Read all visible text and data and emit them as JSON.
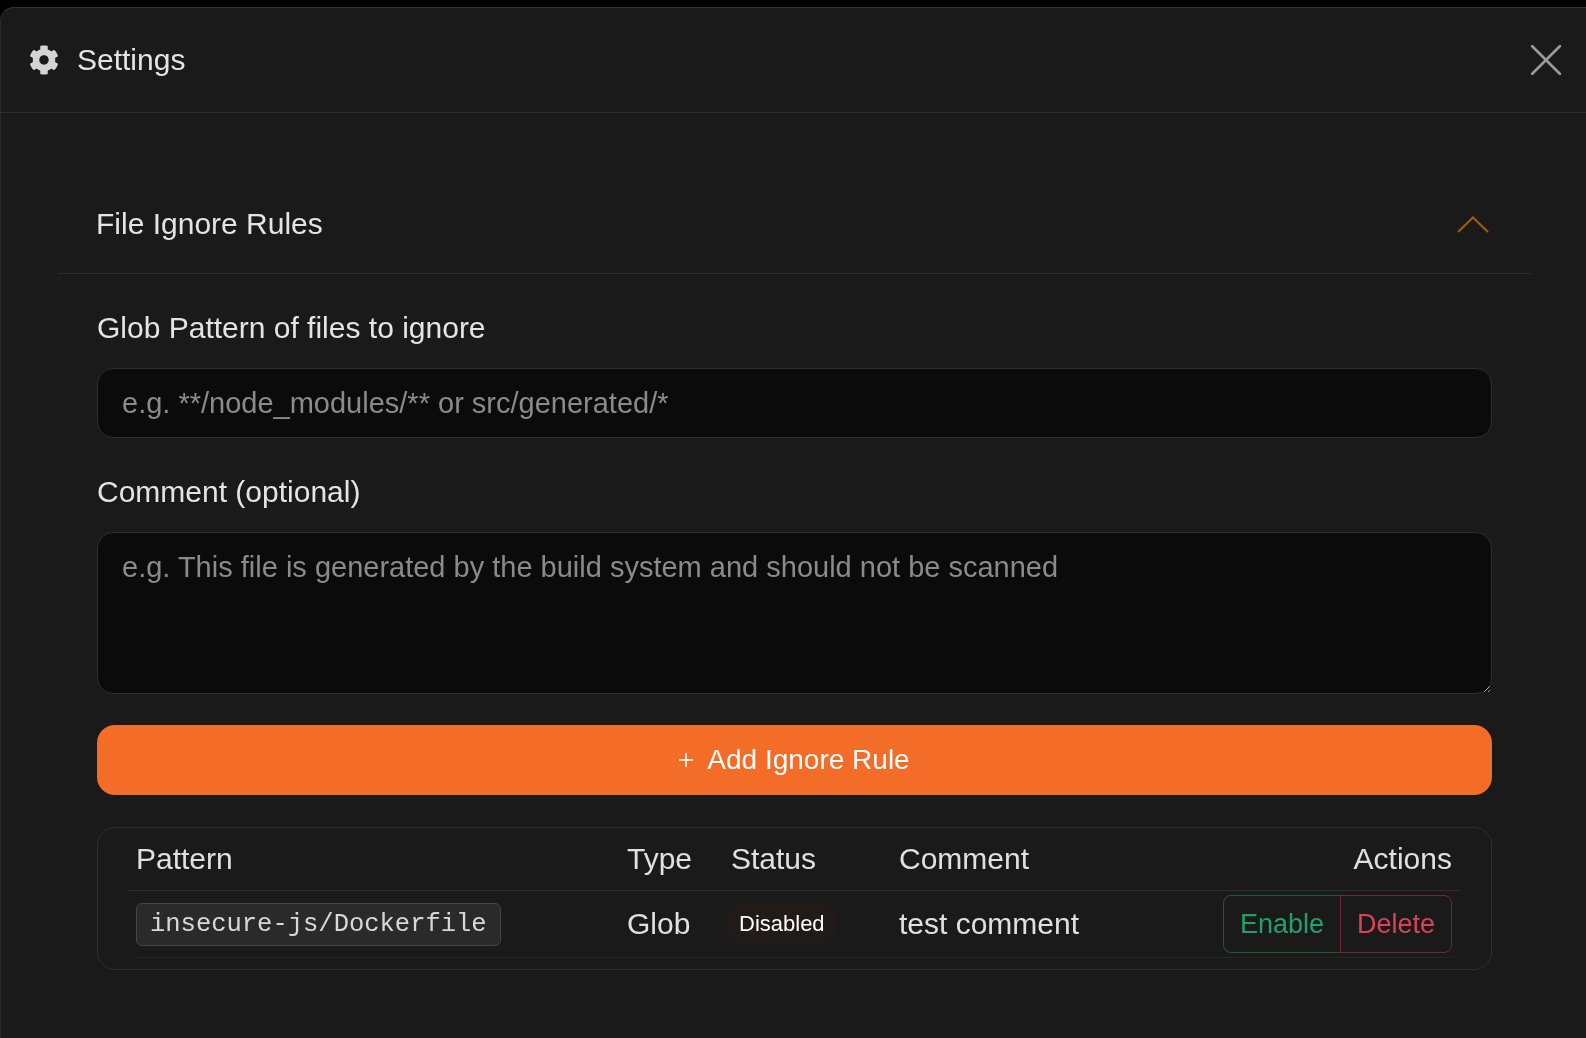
{
  "window": {
    "title": "Settings"
  },
  "section": {
    "title": "File Ignore Rules",
    "expanded": true
  },
  "fields": [
    {
      "kind": "input",
      "label": "Glob Pattern of files to ignore",
      "placeholder": "e.g. **/node_modules/** or src/generated/*"
    },
    {
      "kind": "textarea",
      "label": "Comment (optional)",
      "placeholder": "e.g. This file is generated by the build system and should not be scanned"
    }
  ],
  "add_button": {
    "label": "Add Ignore Rule"
  },
  "table": {
    "columns": [
      "Pattern",
      "Type",
      "Status",
      "Comment",
      "Actions"
    ],
    "rows": [
      {
        "pattern": "insecure-js/Dockerfile",
        "type": "Glob",
        "status": "Disabled",
        "comment": "test comment",
        "actions": [
          {
            "kind": "enable",
            "label": "Enable"
          },
          {
            "kind": "delete",
            "label": "Delete"
          }
        ]
      }
    ]
  }
}
